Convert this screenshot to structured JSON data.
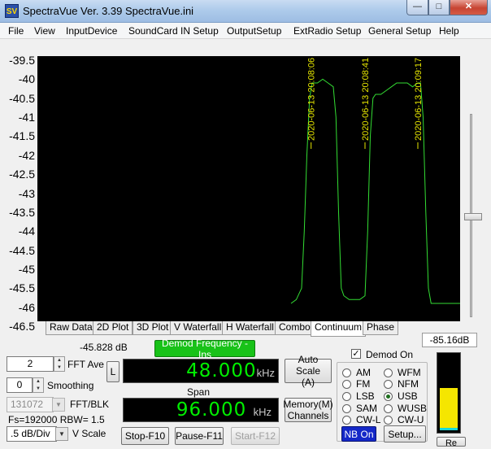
{
  "window": {
    "title": "SpectraVue Ver. 3.39  SpectraVue.ini",
    "icon": "SV",
    "minimize_icon": "minimize-icon",
    "maximize_icon": "maximize-icon",
    "close_icon": "close-icon"
  },
  "menu": [
    "File",
    "View",
    "InputDevice",
    "SoundCard IN Setup",
    "OutputSetup",
    "ExtRadio Setup",
    "General Setup",
    "Help"
  ],
  "chart_data": {
    "type": "line",
    "title": "",
    "xlabel": "",
    "ylabel": "",
    "y_ticks": [
      "-39.5",
      "-40",
      "-40.5",
      "-41",
      "-41.5",
      "-42",
      "-42.5",
      "-43",
      "-43.5",
      "-44",
      "-44.5",
      "-45",
      "-45.5",
      "-46",
      "-46.5"
    ],
    "ylim": [
      -46.5,
      -39.5
    ],
    "xlim": [
      0,
      100
    ],
    "grid": false,
    "background": "#000000",
    "trace_color": "#33dd33",
    "marker_color": "#e6e600",
    "series": [
      {
        "points": [
          [
            78.0,
            -45.9
          ],
          [
            79.0,
            -45.8
          ],
          [
            80.0,
            -45.5
          ],
          [
            80.5,
            -44.0
          ],
          [
            81.0,
            -42.0
          ],
          [
            81.5,
            -40.5
          ],
          [
            82.0,
            -40.1
          ],
          [
            83.0,
            -40.1
          ],
          [
            84.0,
            -40.0
          ],
          [
            85.0,
            -40.1
          ],
          [
            86.0,
            -40.2
          ],
          [
            86.5,
            -41.0
          ],
          [
            87.0,
            -43.5
          ],
          [
            87.5,
            -45.5
          ],
          [
            88.0,
            -45.7
          ],
          [
            89.0,
            -45.8
          ],
          [
            90.0,
            -45.8
          ],
          [
            91.0,
            -45.8
          ],
          [
            92.0,
            -45.7
          ],
          [
            92.5,
            -44.0
          ],
          [
            93.0,
            -41.5
          ],
          [
            93.5,
            -40.5
          ],
          [
            94.0,
            -40.4
          ],
          [
            95.0,
            -40.4
          ],
          [
            96.0,
            -40.3
          ],
          [
            97.0,
            -40.2
          ],
          [
            98.0,
            -40.1
          ],
          [
            99.0,
            -40.1
          ],
          [
            100.0,
            -40.1
          ],
          [
            101.0,
            -40.2
          ],
          [
            102.0,
            -40.1
          ],
          [
            102.5,
            -40.1
          ],
          [
            103.0,
            -41.0
          ],
          [
            103.5,
            -43.5
          ],
          [
            104.0,
            -45.5
          ],
          [
            104.5,
            -45.9
          ],
          [
            106.0,
            -45.9
          ],
          [
            108.0,
            -45.9
          ],
          [
            110.0,
            -45.9
          ]
        ]
      }
    ],
    "annotations": [
      {
        "text": "2020-06-13 20:08:06",
        "x": 81.8
      },
      {
        "text": "2020-06-13 20:08:41",
        "x": 92.0
      },
      {
        "text": "2020-06-13 20:09:17",
        "x": 102.0
      }
    ]
  },
  "tabs": [
    "Raw Data",
    "2D Plot",
    "3D Plot",
    "V Waterfall",
    "H Waterfall",
    "Combo",
    "Continuum",
    "Phase"
  ],
  "active_tab": "Continuum",
  "readouts": {
    "level_left": "-45.828 dB",
    "level_right": "-85.16dB"
  },
  "controls": {
    "fft_ave_value": "2",
    "fft_ave_label": "FFT Ave",
    "smoothing_value": "0",
    "smoothing_label": "Smoothing",
    "fft_blk_value": "131072",
    "fft_blk_label": "FFT/BLK",
    "fs_text": "Fs=192000 RBW= 1.5",
    "vscale_value": ".5 dB/Div",
    "vscale_label": "V Scale",
    "demod_freq_button": "Demod Frequency - Ins",
    "l_button": "L",
    "freq_value": "48.000",
    "freq_unit": "kHz",
    "span_label": "Span",
    "span_value": "96.000",
    "span_unit": "kHz",
    "autoscale_line1": "Auto Scale",
    "autoscale_line2": "(A)",
    "memory_line1": "Memory(M)",
    "memory_line2": "Channels",
    "stop_button": "Stop-F10",
    "pause_button": "Pause-F11",
    "start_button": "Start-F12",
    "demod_on_label": "Demod On",
    "demod_on_checked": "✓",
    "nb_button": "NB On",
    "setup_button": "Setup...",
    "bottom_right_button": "Re",
    "audio_level_fraction": 0.55
  },
  "demod_modes": {
    "left": [
      "AM",
      "FM",
      "LSB",
      "SAM",
      "CW-L"
    ],
    "right": [
      "WFM",
      "NFM",
      "USB",
      "WUSB",
      "CW-U"
    ],
    "selected": "USB"
  }
}
